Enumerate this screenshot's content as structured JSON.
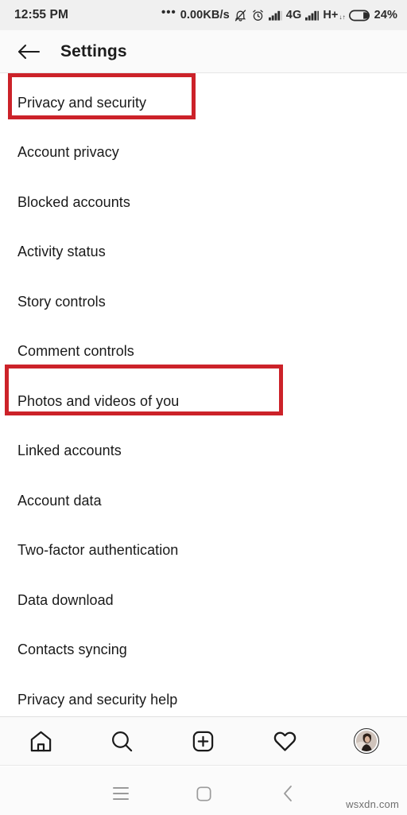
{
  "status_bar": {
    "clock": "12:55 PM",
    "network_speed": "0.00KB/s",
    "more_icon": "•••",
    "mute_icon": "bell-muted-icon",
    "alarm_icon": "alarm-clock-icon",
    "signal1_icon": "signal-bars-icon",
    "network_type_1": "4G",
    "signal2_icon": "signal-bars-icon",
    "network_type_2": "H+",
    "network_type_2_sub": "↓↑",
    "battery_icon": "battery-icon",
    "battery_percent": "24%"
  },
  "header": {
    "back_icon": "back-arrow-icon",
    "title": "Settings"
  },
  "list": {
    "items": [
      {
        "label": "Privacy and security",
        "highlighted": true
      },
      {
        "label": "Account privacy",
        "highlighted": false
      },
      {
        "label": "Blocked accounts",
        "highlighted": false
      },
      {
        "label": "Activity status",
        "highlighted": false
      },
      {
        "label": "Story controls",
        "highlighted": false
      },
      {
        "label": "Comment controls",
        "highlighted": false
      },
      {
        "label": "Photos and videos of you",
        "highlighted": true
      },
      {
        "label": "Linked accounts",
        "highlighted": false
      },
      {
        "label": "Account data",
        "highlighted": false
      },
      {
        "label": "Two-factor authentication",
        "highlighted": false
      },
      {
        "label": "Data download",
        "highlighted": false
      },
      {
        "label": "Contacts syncing",
        "highlighted": false
      },
      {
        "label": "Privacy and security help",
        "highlighted": false
      }
    ]
  },
  "annotations": {
    "highlight_color": "#cc2229",
    "boxes": [
      {
        "target": "Privacy and security"
      },
      {
        "target": "Photos and videos of you"
      }
    ]
  },
  "bottom_nav": {
    "items": [
      {
        "icon": "home-icon",
        "name": "nav-home"
      },
      {
        "icon": "search-icon",
        "name": "nav-search"
      },
      {
        "icon": "add-post-icon",
        "name": "nav-add"
      },
      {
        "icon": "heart-icon",
        "name": "nav-activity"
      },
      {
        "icon": "avatar-icon",
        "name": "nav-profile"
      }
    ]
  },
  "system_nav": {
    "menu_icon": "menu-icon",
    "home_icon": "home-square-icon",
    "back_icon": "back-chevron-icon"
  },
  "watermark": {
    "text": "wsxdn.com"
  }
}
